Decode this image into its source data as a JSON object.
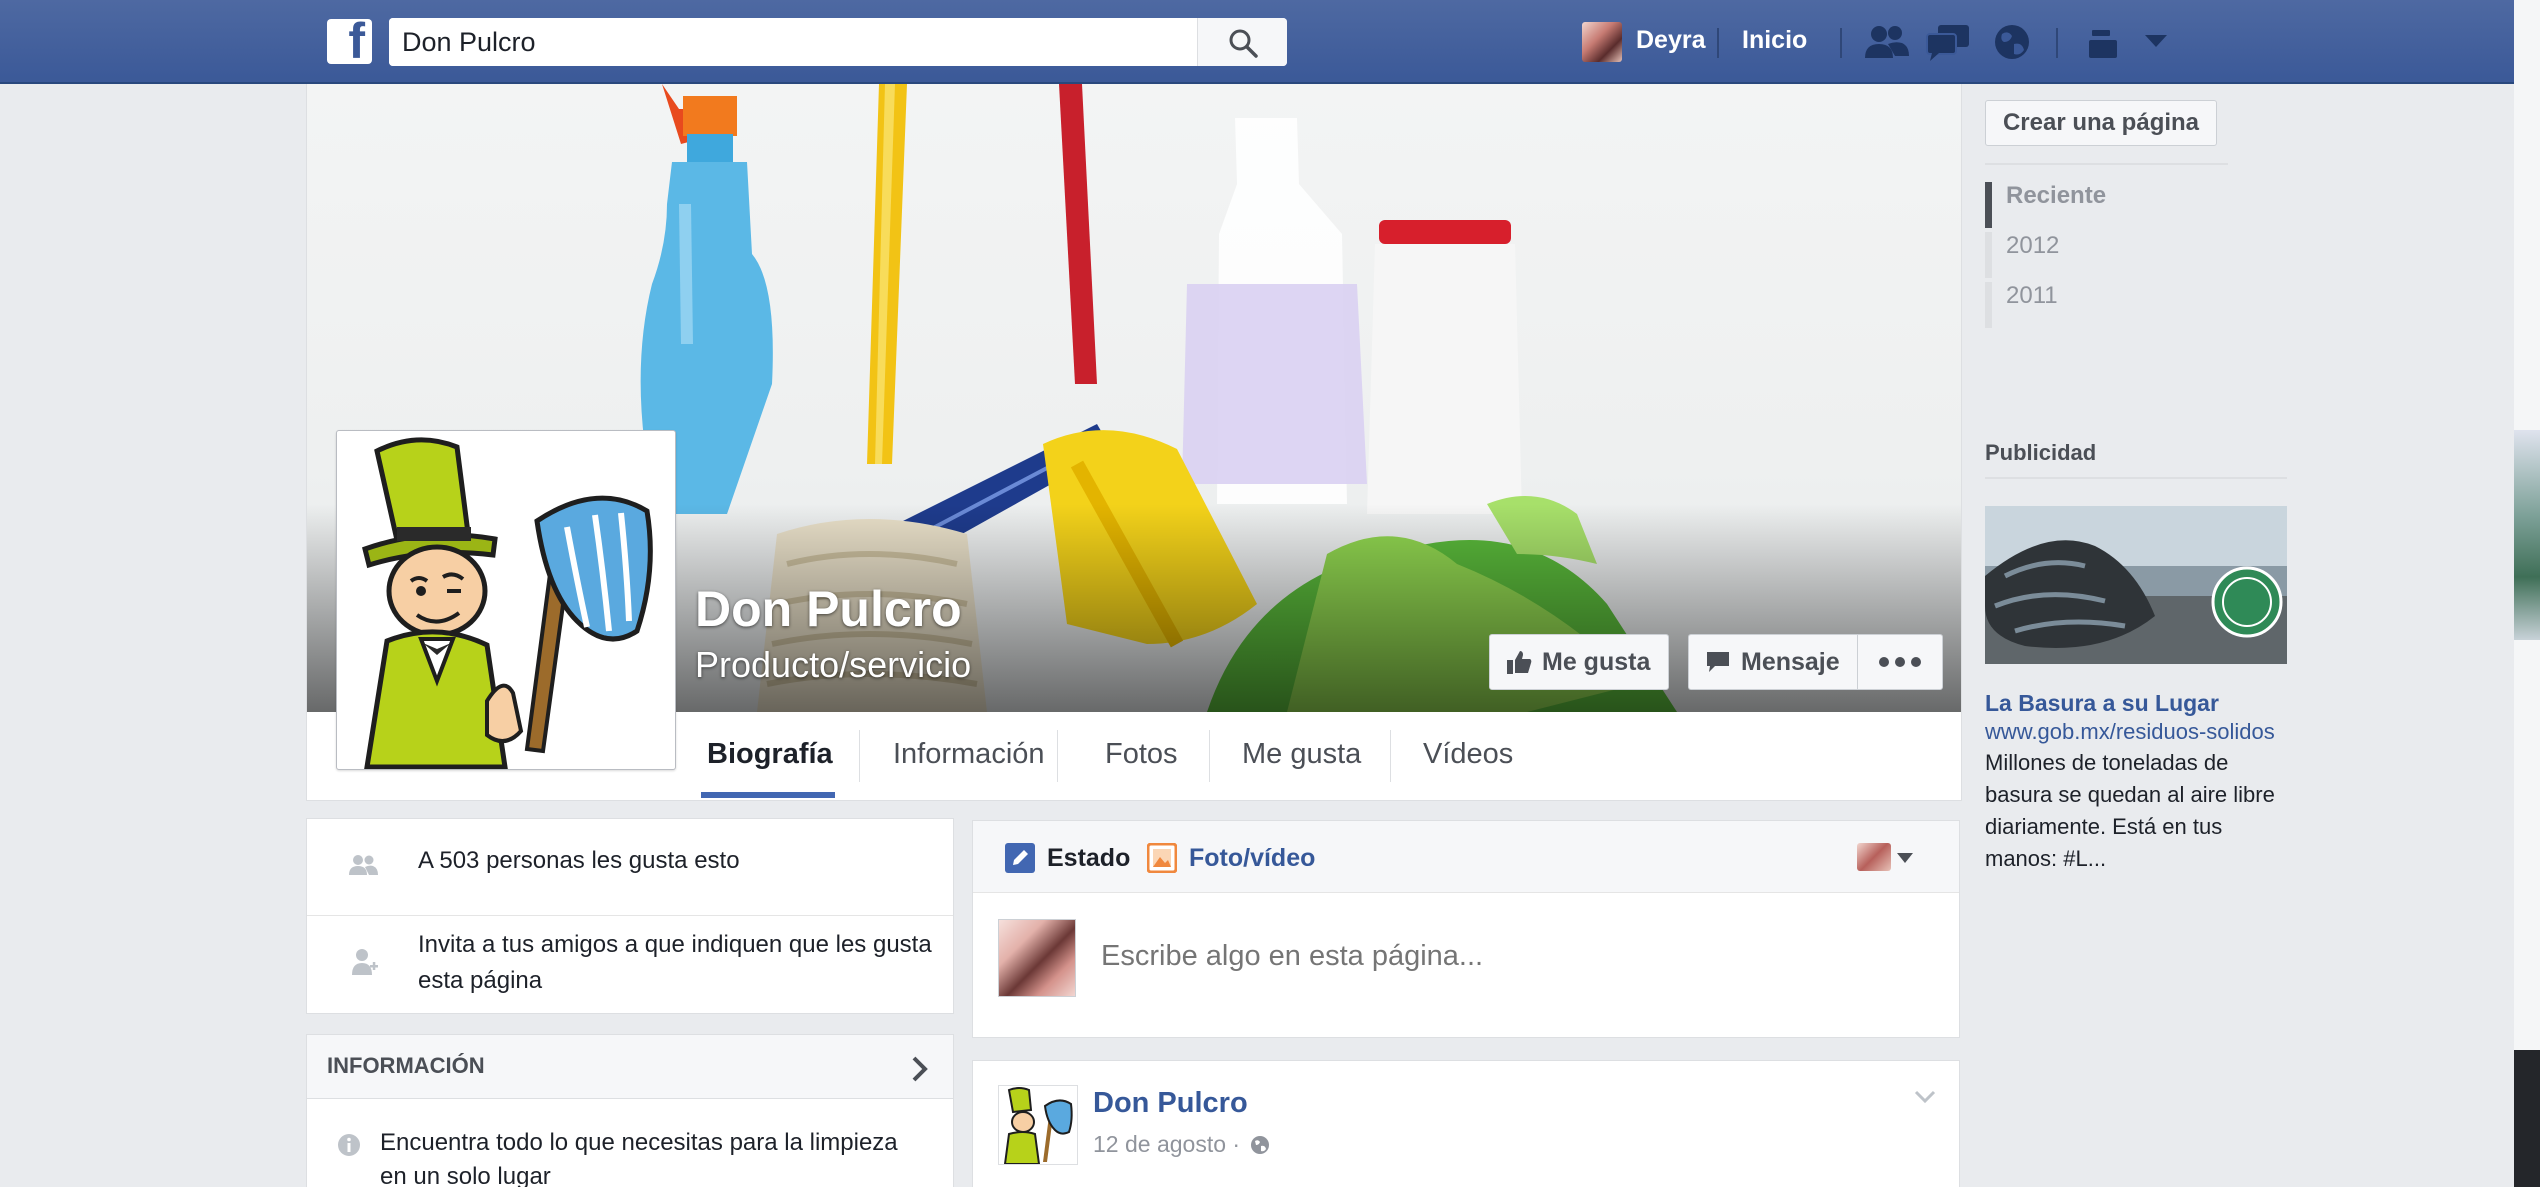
{
  "topbar": {
    "logo_letter": "f",
    "search_value": "Don Pulcro",
    "user_name": "Deyra",
    "home_label": "Inicio"
  },
  "page": {
    "name": "Don Pulcro",
    "category": "Producto/servicio",
    "like_button": "Me gusta",
    "message_button": "Mensaje",
    "tabs": [
      {
        "label": "Biografía",
        "active": true
      },
      {
        "label": "Información"
      },
      {
        "label": "Fotos"
      },
      {
        "label": "Me gusta"
      },
      {
        "label": "Vídeos"
      }
    ]
  },
  "sidebar_left": {
    "likes_count_text": "A 503 personas les gusta esto",
    "invite_text_line1": "Invita a tus amigos a que indiquen que les gusta",
    "invite_text_line2": "esta página",
    "info_title": "INFORMACIÓN",
    "about_line1": "Encuentra todo lo que necesitas para la limpieza",
    "about_line2": "en un solo lugar"
  },
  "composer": {
    "status_tab": "Estado",
    "photo_tab": "Foto/vídeo",
    "placeholder": "Escribe algo en esta página..."
  },
  "post": {
    "author": "Don Pulcro",
    "date": "12 de agosto ·"
  },
  "right_column": {
    "create_page_button": "Crear una página",
    "timeline": [
      {
        "label": "Reciente",
        "active": true
      },
      {
        "label": "2012"
      },
      {
        "label": "2011"
      }
    ],
    "ad_heading": "Publicidad",
    "ad": {
      "title": "La Basura a su Lugar",
      "url": "www.gob.mx/residuos-solidos",
      "text": "Millones de toneladas de basura se quedan al aire libre diariamente. Está en tus manos: #L..."
    }
  },
  "colors": {
    "facebook_blue": "#3b5998",
    "link_blue": "#365899",
    "active_tab_underline": "#4267b2",
    "page_background": "#e9ebee"
  }
}
